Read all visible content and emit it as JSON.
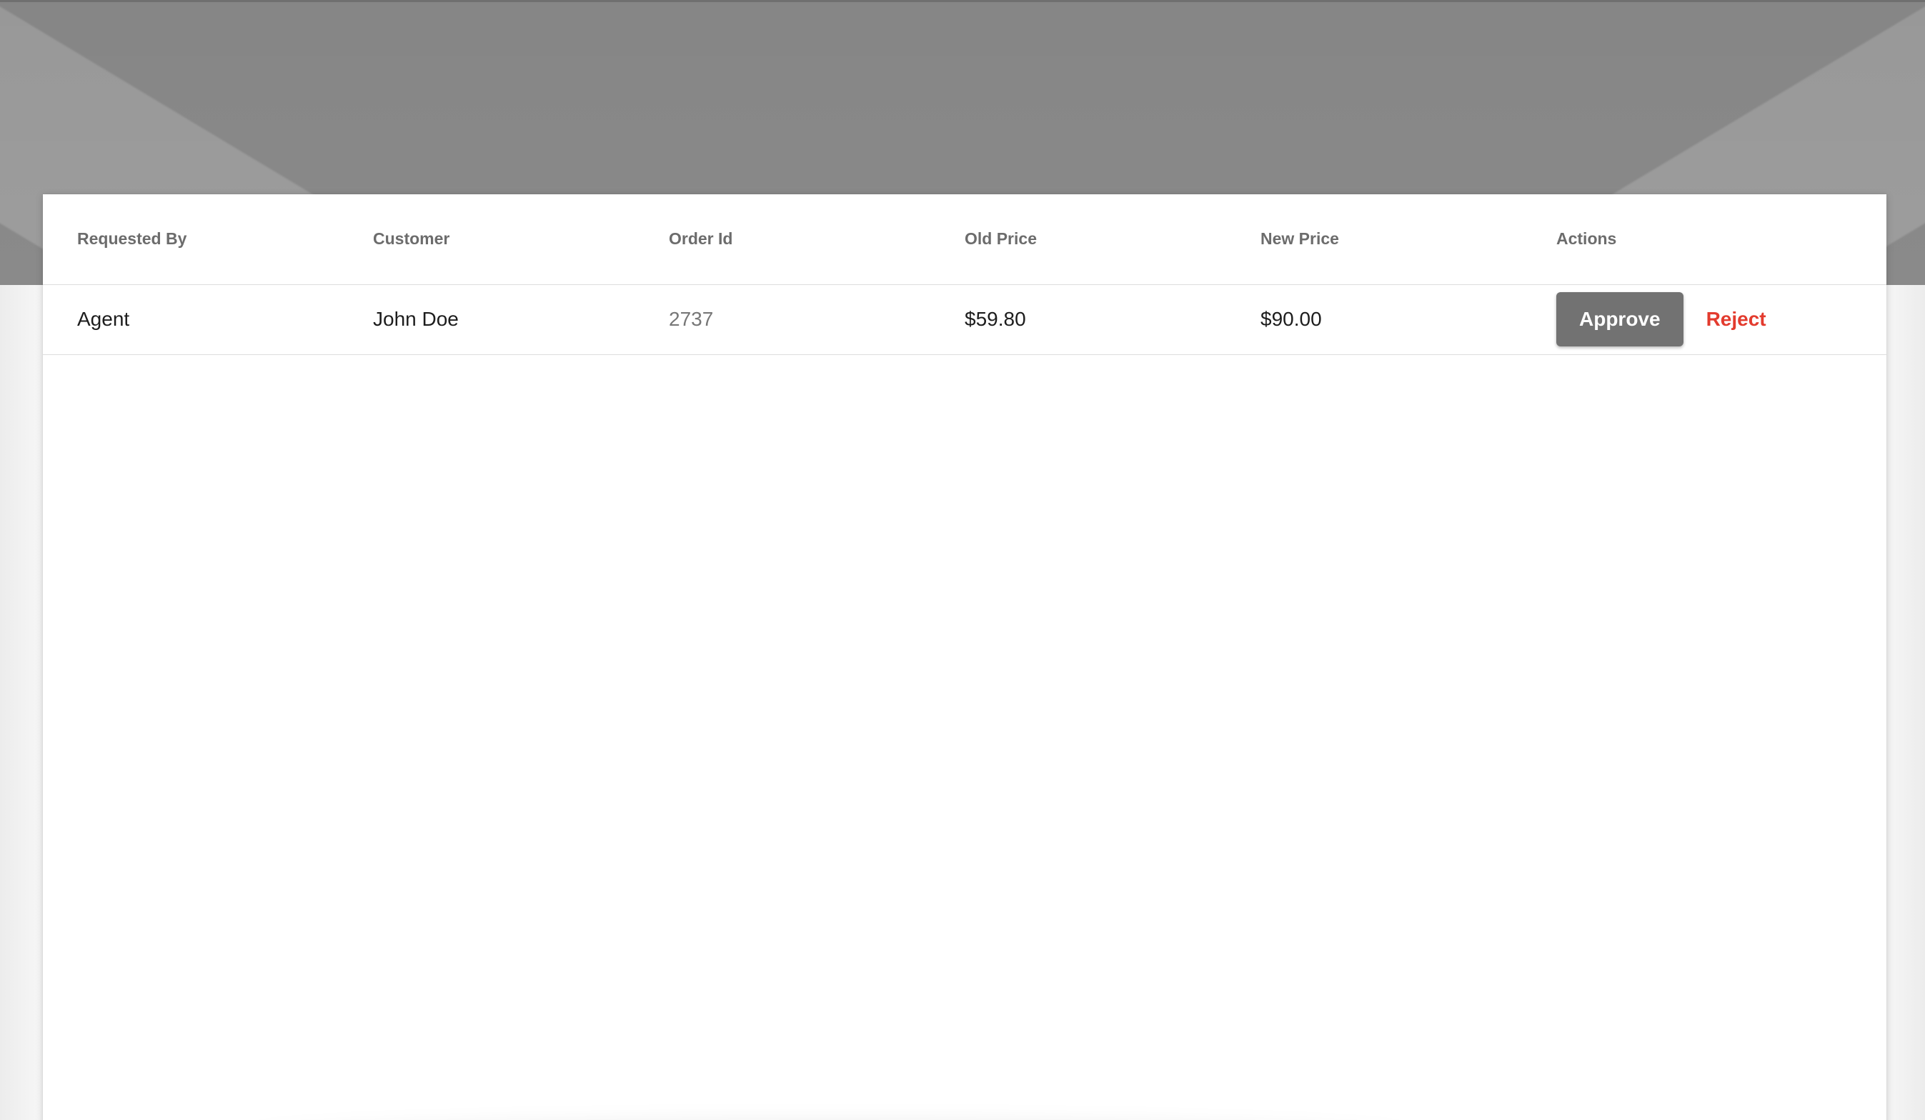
{
  "table": {
    "headers": [
      "Requested By",
      "Customer",
      "Order Id",
      "Old Price",
      "New Price",
      "Actions"
    ],
    "rows": [
      {
        "requested_by": "Agent",
        "customer": "John Doe",
        "order_id": "2737",
        "old_price": "$59.80",
        "new_price": "$90.00",
        "actions": {
          "approve_label": "Approve",
          "reject_label": "Reject"
        }
      }
    ]
  },
  "colors": {
    "hero_background": "#8a8a8a",
    "approve_button": "#727272",
    "reject_text": "#e33b2e",
    "header_text": "#6c6c6c",
    "body_text": "#1d1d1d",
    "muted_text": "#777777"
  }
}
